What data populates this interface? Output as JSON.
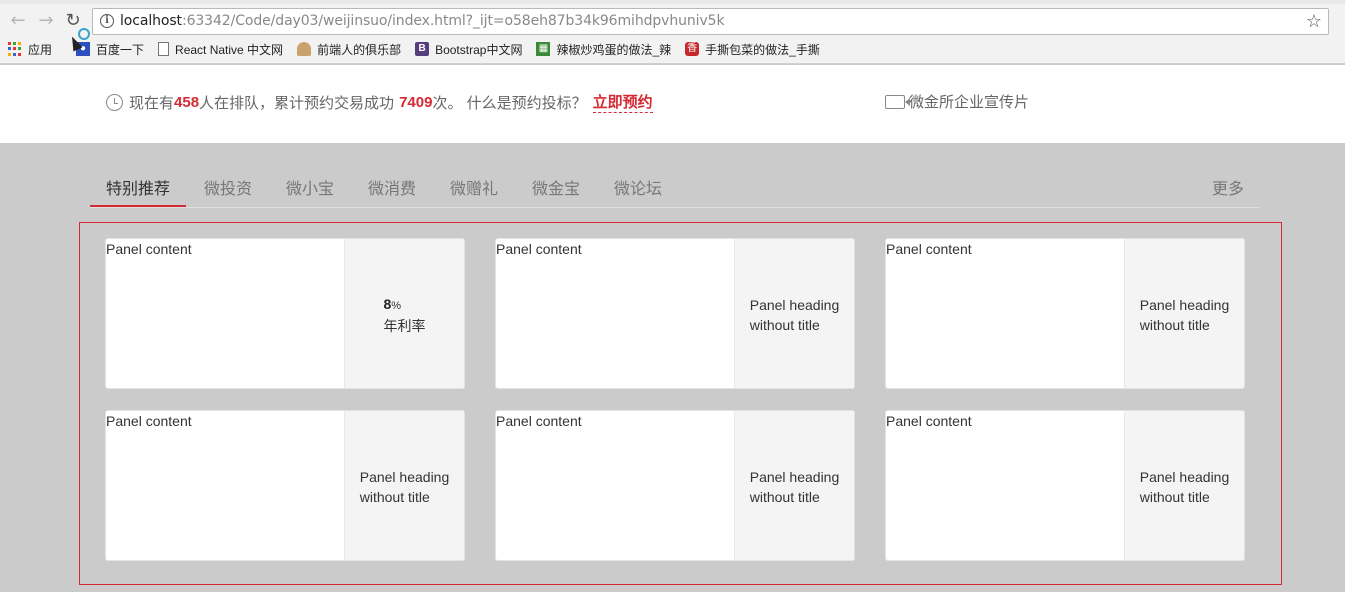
{
  "browser": {
    "url_host": "localhost",
    "url_rest": ":63342/Code/day03/weijinsuo/index.html?_ijt=o58eh87b34k96mihdpvhuniv5k",
    "bookmarks": [
      {
        "label": "应用",
        "icon": "apps-icon"
      },
      {
        "label": "百度一下",
        "icon": "baidu-icon"
      },
      {
        "label": "React Native 中文网",
        "icon": "page-icon"
      },
      {
        "label": "前端人的俱乐部",
        "icon": "person-icon"
      },
      {
        "label": "Bootstrap中文网",
        "icon": "bootstrap-icon"
      },
      {
        "label": "辣椒炒鸡蛋的做法_辣",
        "icon": "recipe-icon"
      },
      {
        "label": "手撕包菜的做法_手撕",
        "icon": "xiang-icon"
      }
    ]
  },
  "notice": {
    "prefix": "现在有",
    "queue_count": "458",
    "middle": "人在排队，累计预约交易成功",
    "deal_count": "7409",
    "suffix": "次。 什么是预约投标？",
    "book_link": "立即预约"
  },
  "promo": {
    "label": "微金所企业宣传片"
  },
  "tabs": [
    {
      "label": "特别推荐",
      "active": true
    },
    {
      "label": "微投资",
      "active": false
    },
    {
      "label": "微小宝",
      "active": false
    },
    {
      "label": "微消费",
      "active": false
    },
    {
      "label": "微赠礼",
      "active": false
    },
    {
      "label": "微金宝",
      "active": false
    },
    {
      "label": "微论坛",
      "active": false
    }
  ],
  "more_label": "更多",
  "panels": [
    {
      "content": "Panel content",
      "rate": "8",
      "rate_unit": "%",
      "rate_label": "年利率"
    },
    {
      "content": "Panel content",
      "heading_line1": "Panel heading",
      "heading_line2": "without title"
    },
    {
      "content": "Panel content",
      "heading_line1": "Panel heading",
      "heading_line2": "without title"
    },
    {
      "content": "Panel content",
      "heading_line1": "Panel heading",
      "heading_line2": "without title"
    },
    {
      "content": "Panel content",
      "heading_line1": "Panel heading",
      "heading_line2": "without title"
    },
    {
      "content": "Panel content",
      "heading_line1": "Panel heading",
      "heading_line2": "without title"
    }
  ],
  "colors": {
    "accent": "#d52a32",
    "page_bg": "#cbcbcb",
    "panel_side_bg": "#f4f4f4"
  }
}
